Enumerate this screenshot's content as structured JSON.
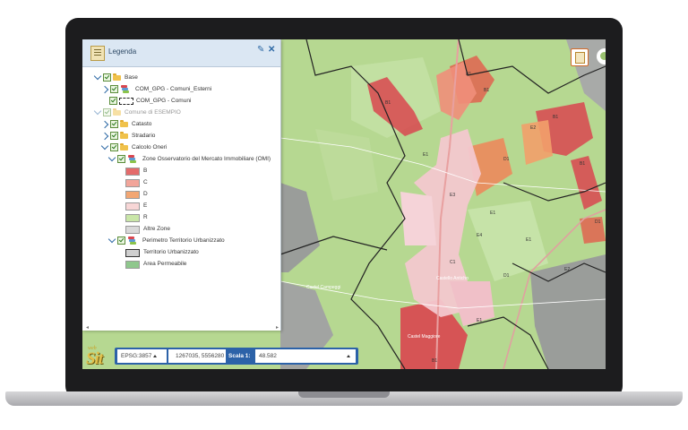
{
  "legend": {
    "title": "Legenda",
    "tree": [
      {
        "label": "Base",
        "level": 0
      },
      {
        "label": "COM_GPG - Comuni_Esterni",
        "level": 1
      },
      {
        "label": "COM_GPG - Comuni",
        "level": 1
      },
      {
        "label": "Comune di ESEMPIO",
        "level": 0
      },
      {
        "label": "Catasto",
        "level": 1
      },
      {
        "label": "Stradario",
        "level": 1
      },
      {
        "label": "Calcolo Oneri",
        "level": 1
      },
      {
        "label": "Zone Osservatorio del Mercato Immobiliare (OMI)",
        "level": 2
      },
      {
        "label": "B",
        "color": "#e46b6b"
      },
      {
        "label": "C",
        "color": "#f2a59a"
      },
      {
        "label": "D",
        "color": "#f2a673"
      },
      {
        "label": "E",
        "color": "#f7d6d6"
      },
      {
        "label": "R",
        "color": "#c9e6a8"
      },
      {
        "label": "Altre Zone",
        "color": "#d9d9d9"
      },
      {
        "label": "Perimetro Territorio Urbanizzato",
        "level": 2
      },
      {
        "label": "Territorio Urbanizzato",
        "color": "#cfcfcf"
      },
      {
        "label": "Area Permeabile",
        "color": "#8fc78d"
      }
    ]
  },
  "toolbar": {
    "logo_small": "web",
    "logo_big": "Sit",
    "projection": "EPSG:3857",
    "coordinates": "1267035, 5556280",
    "scale_label": "Scala 1:",
    "scale_value": "48.582"
  },
  "map": {
    "zone_labels": [
      "B1",
      "B1",
      "B1",
      "D1",
      "E1",
      "E2",
      "E3",
      "E4",
      "C1",
      "E1",
      "E1",
      "B1",
      "E2",
      "B1",
      "D1",
      "D1",
      "E1",
      "B1"
    ],
    "place_labels": [
      "Castel Maggiore",
      "Castel Campeggi",
      "Castello Anticho"
    ]
  },
  "colors": {
    "zone_B": "#d9464f",
    "zone_C": "#f08f7a",
    "zone_E": "#f3c8cf",
    "map_green": "#b6d891",
    "map_grey": "#9a9d9a",
    "accent_blue": "#2c62a8"
  }
}
